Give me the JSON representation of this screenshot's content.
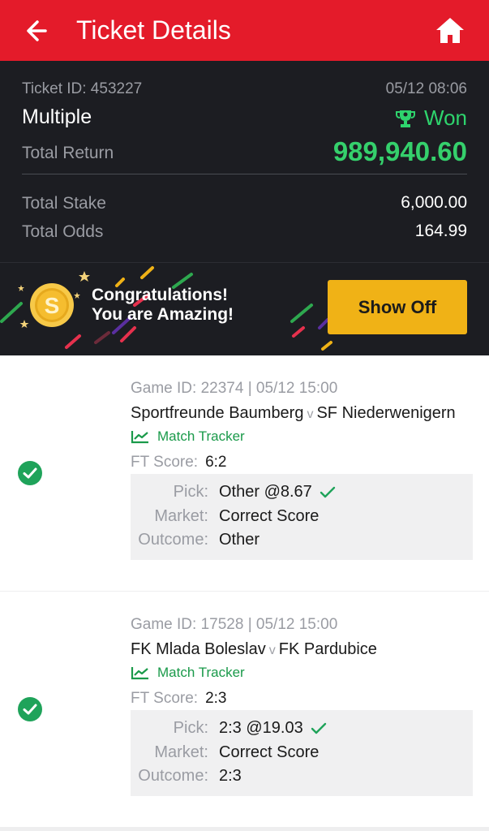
{
  "header": {
    "title": "Ticket Details"
  },
  "summary": {
    "ticket_id_label": "Ticket ID: 453227",
    "datetime": "05/12 08:06",
    "bet_type": "Multiple",
    "status": "Won",
    "total_return_label": "Total Return",
    "total_return_value": "989,940.60",
    "total_stake_label": "Total Stake",
    "total_stake_value": "6,000.00",
    "total_odds_label": "Total Odds",
    "total_odds_value": "164.99"
  },
  "banner": {
    "line1": "Congratulations!",
    "line2": "You are Amazing!",
    "button": "Show Off"
  },
  "bets": [
    {
      "game_id": "Game ID: 22374 | 05/12 15:00",
      "home": "Sportfreunde Baumberg",
      "vs": "v",
      "away": "SF Niederwenigern",
      "tracker": "Match Tracker",
      "ft_label": "FT Score:",
      "ft_value": "6:2",
      "pick_label": "Pick:",
      "pick_value": "Other @8.67",
      "market_label": "Market:",
      "market_value": "Correct Score",
      "outcome_label": "Outcome:",
      "outcome_value": "Other"
    },
    {
      "game_id": "Game ID: 17528 | 05/12 15:00",
      "home": "FK Mlada Boleslav",
      "vs": "v",
      "away": "FK Pardubice",
      "tracker": "Match Tracker",
      "ft_label": "FT Score:",
      "ft_value": "2:3",
      "pick_label": "Pick:",
      "pick_value": "2:3 @19.03",
      "market_label": "Market:",
      "market_value": "Correct Score",
      "outcome_label": "Outcome:",
      "outcome_value": "2:3"
    }
  ],
  "colors": {
    "header_red": "#e41b2a",
    "dark_bg": "#1c1d22",
    "win_green": "#35d06c",
    "check_green": "#1fa35a",
    "button_yellow": "#f0b216"
  },
  "icons": {
    "back": "arrow-left-icon",
    "home": "home-icon",
    "trophy": "trophy-icon",
    "coin": "coin-icon",
    "tracker": "chart-line-icon",
    "status": "check-circle-icon"
  }
}
